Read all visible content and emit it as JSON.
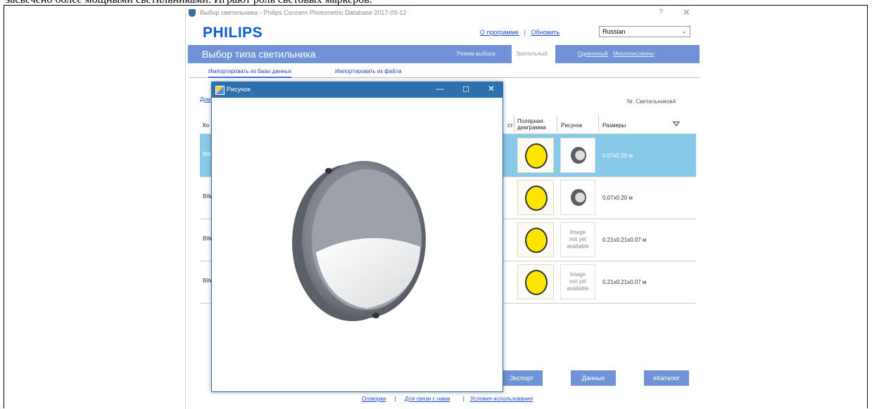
{
  "page": {
    "doc_text": "засвечено более мощными светильниками. Играют роль световых маркеров."
  },
  "window": {
    "title": "Выбор светильника - Philips Concern Photometric Database 2017-09-12",
    "help": "?",
    "close": "✕"
  },
  "header": {
    "logo": "PHILIPS",
    "about_link": "О программе",
    "separator": "|",
    "update_link": "Обновить",
    "language": "Russian"
  },
  "bar": {
    "heading": "Выбор типа светильника",
    "mode_label": "Режим выбора",
    "modes": [
      "Зрительный",
      "Одиночный",
      "Многочисленны"
    ]
  },
  "tabs": [
    "Импортировать из базы данных",
    "Импортировать из файла"
  ],
  "toolbar": {
    "home": "Дом",
    "count_label": "Nr. Светильников4"
  },
  "grid": {
    "headers": {
      "code": "Ко",
      "partial": "ст",
      "polar": "Полярная\nдиаграмма",
      "picture": "Рисунок",
      "size": "Размеры"
    },
    "rows": [
      {
        "code": "BW",
        "image_text": "",
        "dims": "0.07x0.20 м",
        "selected": true
      },
      {
        "code": "BW",
        "image_text": "",
        "dims": "0.07x0.20 м",
        "selected": false
      },
      {
        "code": "BW",
        "image_text": "Image\nnot yet\navailable",
        "dims": "0.21x0.21x0.07 м",
        "selected": false
      },
      {
        "code": "BW",
        "image_text": "Image\nnot yet\navailable",
        "dims": "0.21x0.21x0.07 м",
        "selected": false
      }
    ]
  },
  "buttons": {
    "export": "Экспорт",
    "data": "Данные",
    "ecatalog": "eКаталог"
  },
  "footer": {
    "disclaimer": "Оговорки",
    "contact": "Для связи с нами",
    "terms": "Условия использования",
    "sep": "|"
  },
  "dialog": {
    "title": "Рисунок",
    "minimize": "—",
    "maximize": "☐",
    "close": "✕"
  },
  "colors": {
    "accent": "#6f93d6",
    "selected_row": "#89c9e8",
    "dialog_title": "#2e6fad",
    "polar_fill": "#ffe400"
  }
}
